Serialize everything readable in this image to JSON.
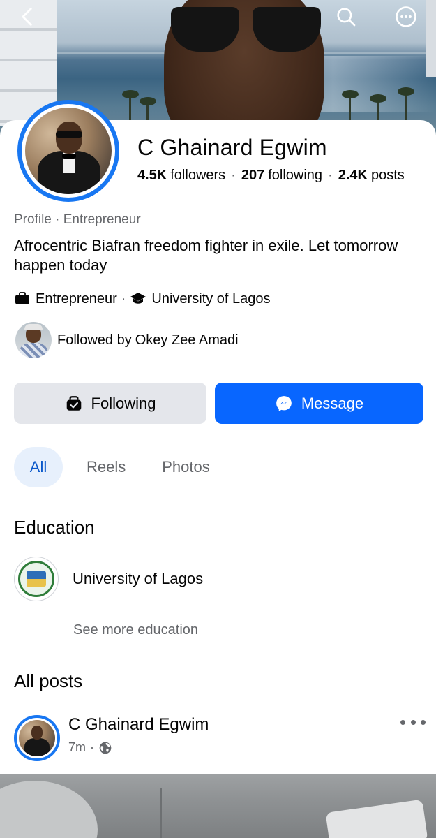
{
  "profile": {
    "name": "C Ghainard Egwim",
    "followers_count": "4.5K",
    "followers_label": "followers",
    "following_count": "207",
    "following_label": "following",
    "posts_count": "2.4K",
    "posts_label": "posts",
    "category": "Profile · Entrepreneur",
    "bio": "Afrocentric Biafran freedom fighter in exile. Let tomorrow happen today",
    "detail_work": "Entrepreneur",
    "detail_school": "University of Lagos",
    "followed_by_prefix": "Followed by",
    "followed_by_name": "Okey Zee Amadi"
  },
  "actions": {
    "following_label": "Following",
    "message_label": "Message"
  },
  "tabs": [
    {
      "label": "All",
      "active": true
    },
    {
      "label": "Reels",
      "active": false
    },
    {
      "label": "Photos",
      "active": false
    }
  ],
  "education": {
    "title": "Education",
    "school": "University of Lagos",
    "see_more": "See more education"
  },
  "posts": {
    "title": "All posts",
    "author": "C Ghainard Egwim",
    "time": "7m",
    "audience_icon": "globe-icon"
  },
  "colors": {
    "accent": "#0866ff",
    "ring": "#1877f2",
    "secondary_button": "#e4e6eb",
    "active_tab_bg": "#e7f0fc",
    "active_tab_text": "#0a58ca",
    "muted_text": "#65676b"
  },
  "icons": {
    "back": "chevron-left-icon",
    "search": "search-icon",
    "more": "more-options-icon",
    "work": "briefcase-icon",
    "school": "graduation-cap-icon",
    "following": "following-check-icon",
    "message": "messenger-icon"
  }
}
